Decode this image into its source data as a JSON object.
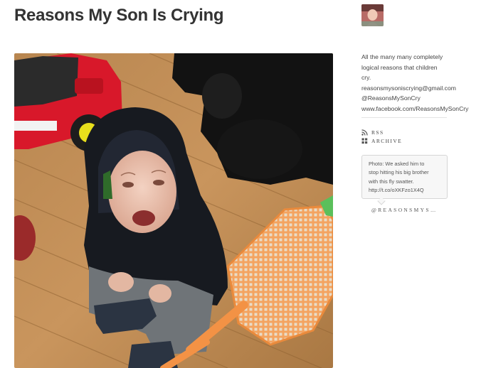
{
  "blog": {
    "title": "Reasons My Son Is Crying"
  },
  "post": {
    "photo_alt": "Crying toddler in a black hooded jacket sitting on a wooden floor next to an orange fly swatter"
  },
  "sidebar": {
    "description_lines": [
      "All the many many completely",
      "logical reasons that children",
      "cry.",
      "reasonsmysoniscrying@gmail.com",
      "@ReasonsMySonCry",
      "www.facebook.com/ReasonsMySonCry"
    ],
    "nav": {
      "rss_label": "RSS",
      "archive_label": "ARCHIVE"
    },
    "tweet": {
      "lines": [
        "Photo: We asked him to",
        "stop hitting his big brother",
        "with this fly swatter.",
        "http://t.co/oXKFzo1X4Q"
      ],
      "handle": "@REASONSMYS…"
    }
  },
  "icons": {
    "rss": "rss-icon",
    "archive": "grid-icon"
  },
  "colors": {
    "title": "#333333",
    "text": "#444444",
    "tweet_bg": "#f7f7f7",
    "tweet_border": "#d6d6d6"
  }
}
